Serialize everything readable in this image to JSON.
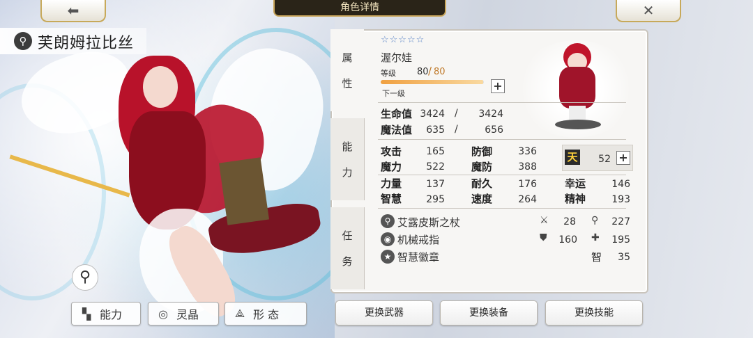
{
  "header": {
    "title": "角色详情"
  },
  "character": {
    "name": "芙朗姆拉比丝",
    "class": "渥尔娃",
    "stars": "☆☆☆☆☆"
  },
  "side_tabs": [
    {
      "chars": [
        "属",
        "性"
      ]
    },
    {
      "chars": [
        "能",
        "力"
      ]
    },
    {
      "chars": [
        "任",
        "务"
      ]
    }
  ],
  "level": {
    "label": "等级",
    "current": "80",
    "slash": "/",
    "max": "80",
    "next_label": "下一级",
    "progress": 0.99
  },
  "vitals": [
    {
      "label": "生命值",
      "current": "3424",
      "slash": "/",
      "max": "3424"
    },
    {
      "label": "魔法值",
      "current": "635",
      "slash": "/",
      "max": "656"
    }
  ],
  "stats": [
    {
      "label": "攻击",
      "value": "165"
    },
    {
      "label": "防御",
      "value": "336"
    },
    {
      "label": "魔力",
      "value": "522"
    },
    {
      "label": "魔防",
      "value": "388"
    },
    {
      "label": "力量",
      "value": "137"
    },
    {
      "label": "耐久",
      "value": "176"
    },
    {
      "label": "幸运",
      "value": "146"
    },
    {
      "label": "智慧",
      "value": "295"
    },
    {
      "label": "速度",
      "value": "264"
    },
    {
      "label": "精神",
      "value": "193"
    }
  ],
  "special": {
    "label": "天",
    "value": "52"
  },
  "equipment": [
    {
      "name": "艾露皮斯之杖",
      "icon": "staff-icon",
      "b1_icon": "sword",
      "b1": "28",
      "b2_icon": "staff",
      "b2": "227"
    },
    {
      "name": "机械戒指",
      "icon": "ring-icon",
      "b1_icon": "shield",
      "b1": "160",
      "b2_icon": "cross",
      "b2": "195"
    },
    {
      "name": "智慧徽章",
      "icon": "badge-icon",
      "b2_label": "智",
      "b2": "35"
    }
  ],
  "bottom_left": [
    {
      "label": "能力",
      "icon": "grid-icon"
    },
    {
      "label": "灵晶",
      "icon": "crystal-icon"
    },
    {
      "label": "形 态",
      "icon": "form-icon"
    }
  ],
  "bottom_right": [
    {
      "label": "更换武器"
    },
    {
      "label": "更换装备"
    },
    {
      "label": "更换技能"
    }
  ]
}
